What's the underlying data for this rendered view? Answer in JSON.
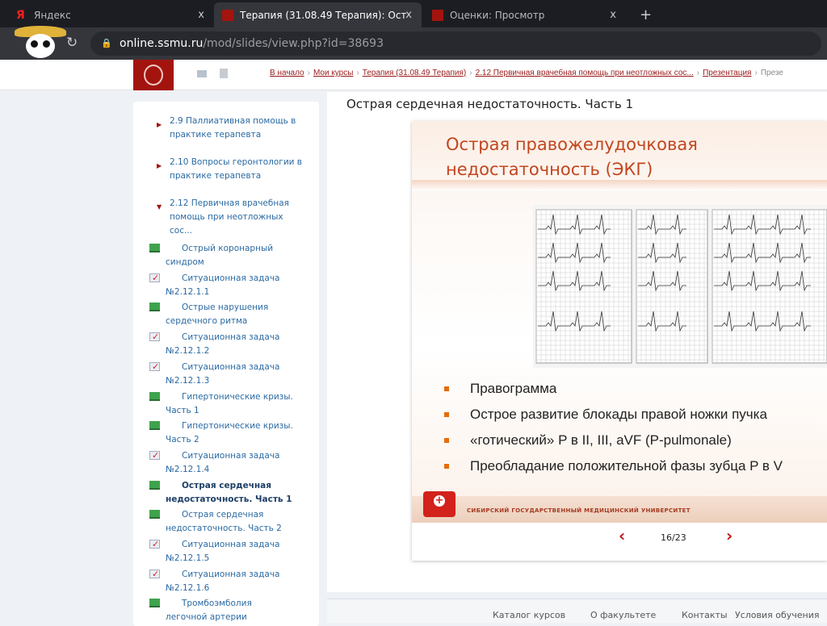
{
  "browser": {
    "tabs": [
      {
        "label": "Яндекс",
        "icon": "yandex-icon",
        "active": false
      },
      {
        "label": "Терапия (31.08.49 Терапия): Ост",
        "icon": "ssmu-icon",
        "active": true
      },
      {
        "label": "Оценки: Просмотр",
        "icon": "ssmu-icon",
        "active": false
      }
    ],
    "close": "x",
    "new_tab": "+",
    "url_domain": "online.ssmu.ru",
    "url_path": "/mod/slides/view.php?id=38693"
  },
  "breadcrumb": [
    "В начало",
    "Мои курсы",
    "Терапия (31.08.49 Терапия)",
    "2.12 Первичная врачебная помощь при неотложных сос...",
    "Презентация",
    "Презе"
  ],
  "sidebar": {
    "sections": [
      {
        "label": "2.9 Паллиативная помощь в практике терапевта"
      },
      {
        "label": "2.10 Вопросы геронтологии в практике терапевта"
      },
      {
        "label": "2.12 Первичная врачебная помощь при неотложных сос..."
      }
    ],
    "items": [
      {
        "label": "Острый коронарный синдром",
        "type": "slides"
      },
      {
        "label": "Ситуационная задача №2.12.1.1",
        "type": "quiz"
      },
      {
        "label": "Острые нарушения сердечного ритма",
        "type": "slides"
      },
      {
        "label": "Ситуационная задача №2.12.1.2",
        "type": "quiz"
      },
      {
        "label": "Ситуационная задача №2.12.1.3",
        "type": "quiz"
      },
      {
        "label": "Гипертонические кризы. Часть 1",
        "type": "slides"
      },
      {
        "label": "Гипертонические кризы. Часть 2",
        "type": "slides"
      },
      {
        "label": "Ситуационная задача №2.12.1.4",
        "type": "quiz"
      },
      {
        "label": "Острая сердечная недостаточность. Часть 1",
        "type": "slides",
        "current": true
      },
      {
        "label": "Острая сердечная недостаточность. Часть 2",
        "type": "slides"
      },
      {
        "label": "Ситуационная задача №2.12.1.5",
        "type": "quiz"
      },
      {
        "label": "Ситуационная задача №2.12.1.6",
        "type": "quiz"
      },
      {
        "label": "Тромбоэмболия легочной артерии",
        "type": "slides"
      }
    ]
  },
  "main": {
    "title": "Острая сердечная недостаточность. Часть 1",
    "slide": {
      "title_line1": "Острая правожелудочковая",
      "title_line2": "недостаточность (ЭКГ)",
      "bullets": [
        "Правограмма",
        "Острое развитие блокады правой ножки пучка",
        "«готический» P в II, III, aVF (P-pulmonale)",
        "Преобладание положительной фазы зубца P в V"
      ],
      "footer": "СИБИРСКИЙ ГОСУДАРСТВЕННЫЙ МЕДИЦИНСКИЙ УНИВЕРСИТЕТ"
    },
    "pager": {
      "prev": "‹",
      "next": "›",
      "text": "16/23",
      "current": 16,
      "total": 23
    }
  },
  "footer": [
    "Каталог курсов",
    "О факультете",
    "Контакты",
    "Условия обучения"
  ],
  "colors": {
    "brand": "#a3140f",
    "link": "#2a6aa3",
    "accent": "#c2461f"
  }
}
